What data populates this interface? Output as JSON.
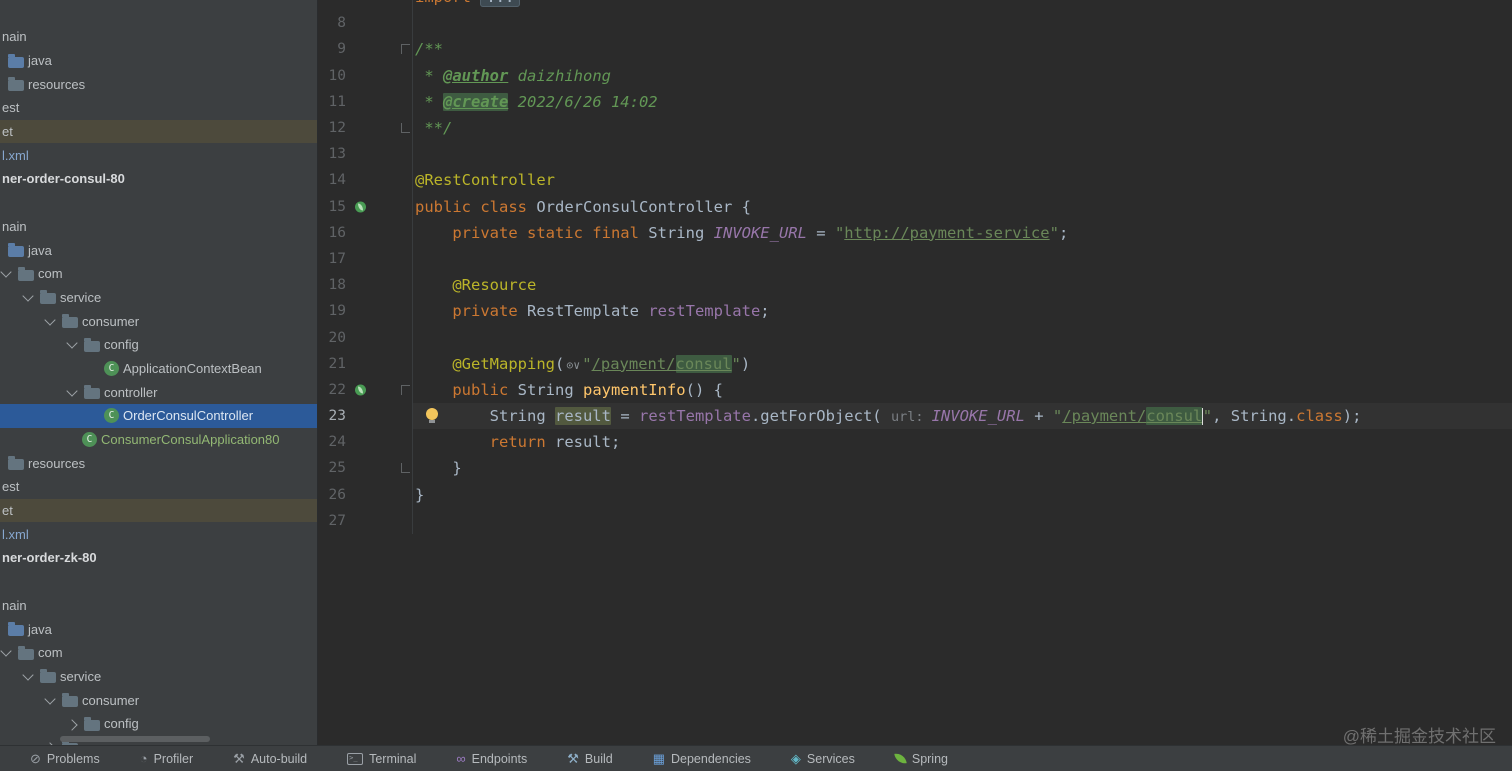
{
  "tree": {
    "items": [
      {
        "label": "nain",
        "pad": 2
      },
      {
        "label": "java",
        "pad": 8,
        "icon": "folder-java-icon"
      },
      {
        "label": "resources",
        "pad": 8,
        "icon": "folder-icon"
      },
      {
        "label": "est",
        "pad": 2
      },
      {
        "label": "et",
        "pad": 2,
        "state": "highlight"
      },
      {
        "label": "l.xml",
        "pad": 2,
        "cls": "xml"
      },
      {
        "label": "ner-order-consul-80",
        "pad": 2,
        "cls": "bold"
      },
      {
        "spacer": true
      },
      {
        "label": "nain",
        "pad": 2
      },
      {
        "label": "java",
        "pad": 8,
        "icon": "folder-java-icon"
      },
      {
        "label": "com",
        "pad": 0,
        "chevron": "down",
        "icon": "folder-icon"
      },
      {
        "label": "service",
        "pad": 22,
        "chevron": "down",
        "icon": "folder-icon"
      },
      {
        "label": "consumer",
        "pad": 44,
        "chevron": "down",
        "icon": "folder-icon"
      },
      {
        "label": "config",
        "pad": 66,
        "chevron": "down",
        "icon": "folder-icon"
      },
      {
        "label": "ApplicationContextBean",
        "pad": 104,
        "icon": "class-icon"
      },
      {
        "label": "controller",
        "pad": 66,
        "chevron": "down",
        "icon": "folder-icon"
      },
      {
        "label": "OrderConsulController",
        "pad": 104,
        "icon": "class-icon",
        "state": "selected"
      },
      {
        "label": "ConsumerConsulApplication80",
        "pad": 82,
        "icon": "class-icon",
        "cls": "green"
      },
      {
        "label": "resources",
        "pad": 8,
        "icon": "folder-icon"
      },
      {
        "label": "est",
        "pad": 2
      },
      {
        "label": "et",
        "pad": 2,
        "state": "highlight"
      },
      {
        "label": "l.xml",
        "pad": 2,
        "cls": "xml"
      },
      {
        "label": "ner-order-zk-80",
        "pad": 2,
        "cls": "bold"
      },
      {
        "spacer": true
      },
      {
        "label": "nain",
        "pad": 2
      },
      {
        "label": "java",
        "pad": 8,
        "icon": "folder-java-icon"
      },
      {
        "label": "com",
        "pad": 0,
        "chevron": "down",
        "icon": "folder-icon"
      },
      {
        "label": "service",
        "pad": 22,
        "chevron": "down",
        "icon": "folder-icon"
      },
      {
        "label": "consumer",
        "pad": 44,
        "chevron": "down",
        "icon": "folder-icon"
      },
      {
        "label": "config",
        "pad": 66,
        "chevron": "right",
        "icon": "folder-icon"
      },
      {
        "label": "",
        "pad": 44,
        "chevron": "right",
        "icon": "folder-icon"
      }
    ]
  },
  "editor": {
    "lines": [
      {
        "num": "",
        "segments": [
          {
            "t": "import ",
            "c": "kw"
          },
          {
            "t": "...",
            "c": "foldbox"
          }
        ]
      },
      {
        "num": "8",
        "segments": []
      },
      {
        "num": "9",
        "fold": "start",
        "segments": [
          {
            "t": "/**",
            "c": "cmt"
          }
        ]
      },
      {
        "num": "10",
        "segments": [
          {
            "t": " * ",
            "c": "cmt"
          },
          {
            "t": "@author",
            "c": "doctag"
          },
          {
            "t": " daizhihong",
            "c": "cmt"
          }
        ]
      },
      {
        "num": "11",
        "segments": [
          {
            "t": " * ",
            "c": "cmt"
          },
          {
            "t": "@create",
            "c": "doctag hl"
          },
          {
            "t": " 2022/6/26 14:02",
            "c": "cmt"
          }
        ]
      },
      {
        "num": "12",
        "fold": "end",
        "segments": [
          {
            "t": " **/",
            "c": "cmt"
          }
        ]
      },
      {
        "num": "13",
        "segments": []
      },
      {
        "num": "14",
        "segments": [
          {
            "t": "@RestController",
            "c": "ann"
          }
        ]
      },
      {
        "num": "15",
        "gicon": "bean",
        "segments": [
          {
            "t": "public class ",
            "c": "kw"
          },
          {
            "t": "OrderConsulController {",
            "c": "plain"
          }
        ]
      },
      {
        "num": "16",
        "segments": [
          {
            "t": "    ",
            "c": "plain"
          },
          {
            "t": "private static final ",
            "c": "kw"
          },
          {
            "t": "String ",
            "c": "plain"
          },
          {
            "t": "INVOKE_URL",
            "c": "const"
          },
          {
            "t": " = ",
            "c": "plain"
          },
          {
            "t": "\"",
            "c": "str"
          },
          {
            "t": "http://payment-service",
            "c": "strlink"
          },
          {
            "t": "\"",
            "c": "str"
          },
          {
            "t": ";",
            "c": "plain"
          }
        ]
      },
      {
        "num": "17",
        "segments": []
      },
      {
        "num": "18",
        "segments": [
          {
            "t": "    ",
            "c": "plain"
          },
          {
            "t": "@Resource",
            "c": "ann"
          }
        ]
      },
      {
        "num": "19",
        "segments": [
          {
            "t": "    ",
            "c": "plain"
          },
          {
            "t": "private ",
            "c": "kw"
          },
          {
            "t": "RestTemplate ",
            "c": "plain"
          },
          {
            "t": "restTemplate",
            "c": "field"
          },
          {
            "t": ";",
            "c": "plain"
          }
        ]
      },
      {
        "num": "20",
        "segments": []
      },
      {
        "num": "21",
        "segments": [
          {
            "t": "    ",
            "c": "plain"
          },
          {
            "t": "@GetMapping",
            "c": "ann"
          },
          {
            "t": "(",
            "c": "plain"
          },
          {
            "icon": "navigate-url-icon"
          },
          {
            "t": "\"",
            "c": "str"
          },
          {
            "t": "/payment/",
            "c": "strlink"
          },
          {
            "t": "consul",
            "c": "strlink hl"
          },
          {
            "t": "\"",
            "c": "str"
          },
          {
            "t": ")",
            "c": "plain"
          }
        ]
      },
      {
        "num": "22",
        "gicon": "bean",
        "fold": "start",
        "segments": [
          {
            "t": "    ",
            "c": "plain"
          },
          {
            "t": "public ",
            "c": "kw"
          },
          {
            "t": "String ",
            "c": "plain"
          },
          {
            "t": "paymentInfo",
            "c": "method"
          },
          {
            "t": "() {",
            "c": "plain"
          }
        ]
      },
      {
        "num": "23",
        "caretLine": true,
        "bulb": true,
        "segments": [
          {
            "t": "        ",
            "c": "plain"
          },
          {
            "t": "String ",
            "c": "plain"
          },
          {
            "t": "result",
            "c": "plain sel"
          },
          {
            "t": " = ",
            "c": "plain"
          },
          {
            "t": "restTemplate",
            "c": "field"
          },
          {
            "t": ".getForObject( ",
            "c": "plain"
          },
          {
            "t": "url: ",
            "c": "hint"
          },
          {
            "t": "INVOKE_URL",
            "c": "const"
          },
          {
            "t": " + ",
            "c": "plain"
          },
          {
            "t": "\"",
            "c": "str"
          },
          {
            "t": "/payment/",
            "c": "strlink"
          },
          {
            "t": "consul",
            "c": "strlink hl"
          },
          {
            "caret": true
          },
          {
            "t": "\"",
            "c": "str"
          },
          {
            "t": ", String.",
            "c": "plain"
          },
          {
            "t": "class",
            "c": "kw"
          },
          {
            "t": ");",
            "c": "plain"
          }
        ]
      },
      {
        "num": "24",
        "segments": [
          {
            "t": "        ",
            "c": "plain"
          },
          {
            "t": "return ",
            "c": "kw"
          },
          {
            "t": "result;",
            "c": "plain"
          }
        ]
      },
      {
        "num": "25",
        "fold": "end",
        "segments": [
          {
            "t": "    }",
            "c": "plain"
          }
        ]
      },
      {
        "num": "26",
        "segments": [
          {
            "t": "}",
            "c": "plain"
          }
        ]
      },
      {
        "num": "27",
        "segments": []
      }
    ]
  },
  "statusbar": {
    "items": [
      {
        "label": "Problems",
        "icon": "problems-icon"
      },
      {
        "label": "Profiler",
        "icon": "profiler-icon"
      },
      {
        "label": "Auto-build",
        "icon": "auto-build-icon"
      },
      {
        "label": "Terminal",
        "icon": "terminal-icon"
      },
      {
        "label": "Endpoints",
        "icon": "endpoints-icon"
      },
      {
        "label": "Build",
        "icon": "build-icon"
      },
      {
        "label": "Dependencies",
        "icon": "dependencies-icon"
      },
      {
        "label": "Services",
        "icon": "services-icon"
      },
      {
        "label": "Spring",
        "icon": "spring-icon"
      }
    ]
  },
  "watermark": {
    "text": "@稀土掘金技术社区"
  },
  "colors": {
    "editor_bg": "#2b2b2b",
    "panel_bg": "#3c3f41",
    "selection_blue": "#2c5a99",
    "keyword": "#cc7832",
    "annotation": "#bbb529",
    "string": "#6a8759",
    "comment": "#629755",
    "constant": "#9876aa",
    "method": "#ffc66b",
    "plain": "#a9b7c6",
    "spring_green": "#6db33f"
  }
}
